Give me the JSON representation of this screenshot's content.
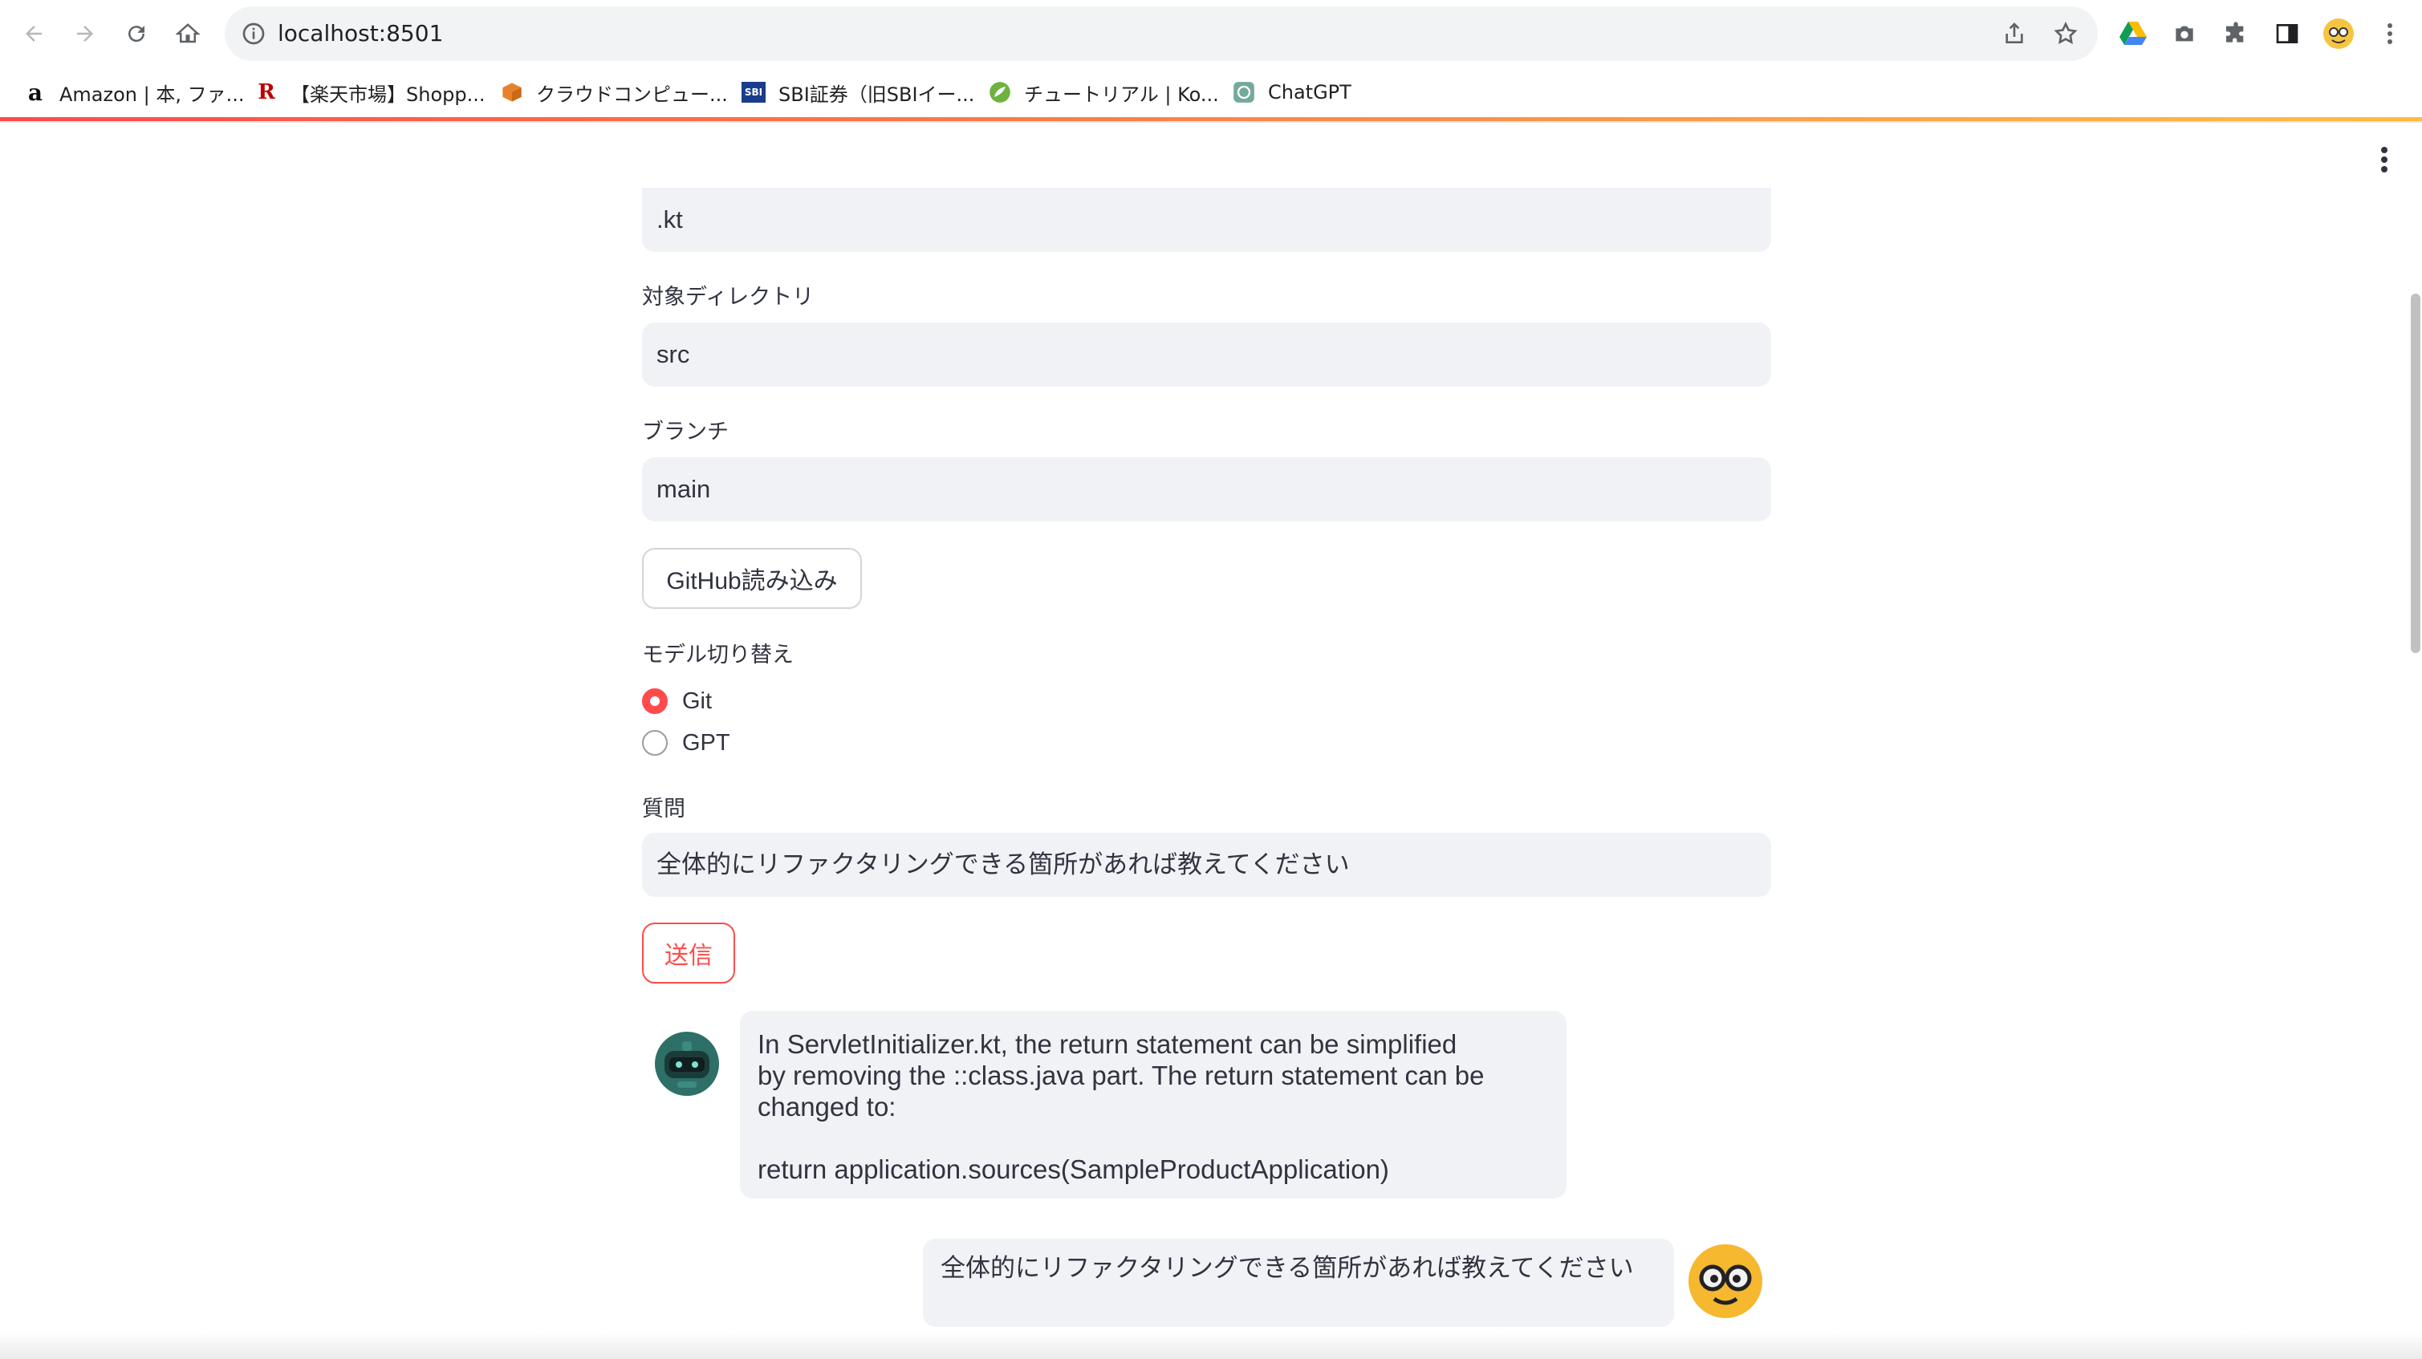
{
  "browser": {
    "url": "localhost:8501",
    "bookmarks": [
      {
        "label": "Amazon | 本, ファ...",
        "icon": "amazon-icon"
      },
      {
        "label": "【楽天市場】Shopp...",
        "icon": "rakuten-icon"
      },
      {
        "label": "クラウドコンピュー...",
        "icon": "aws-cube-icon"
      },
      {
        "label": "SBI証券（旧SBIイー...",
        "icon": "sbi-icon"
      },
      {
        "label": "チュートリアル | Ko...",
        "icon": "spring-leaf-icon"
      },
      {
        "label": "ChatGPT",
        "icon": "chatgpt-icon"
      }
    ]
  },
  "form": {
    "extension_value": ".kt",
    "directory_label": "対象ディレクトリ",
    "directory_value": "src",
    "branch_label": "ブランチ",
    "branch_value": "main",
    "load_button": "GitHub読み込み",
    "model_label": "モデル切り替え",
    "model_options": [
      {
        "label": "Git",
        "selected": true
      },
      {
        "label": "GPT",
        "selected": false
      }
    ],
    "question_label": "質問",
    "question_value": "全体的にリファクタリングできる箇所があれば教えてください",
    "send_button": "送信"
  },
  "chat": {
    "bot_message_lines": [
      "In ServletInitializer.kt, the return statement can be simplified",
      "by removing the ::class.java part. The return statement can be",
      "changed to:",
      "",
      "return application.sources(SampleProductApplication)"
    ],
    "user_message": "全体的にリファクタリングできる箇所があれば教えてください"
  },
  "colors": {
    "accent": "#ff4b4b",
    "field_bg": "#f0f2f6",
    "text": "#31333f"
  }
}
